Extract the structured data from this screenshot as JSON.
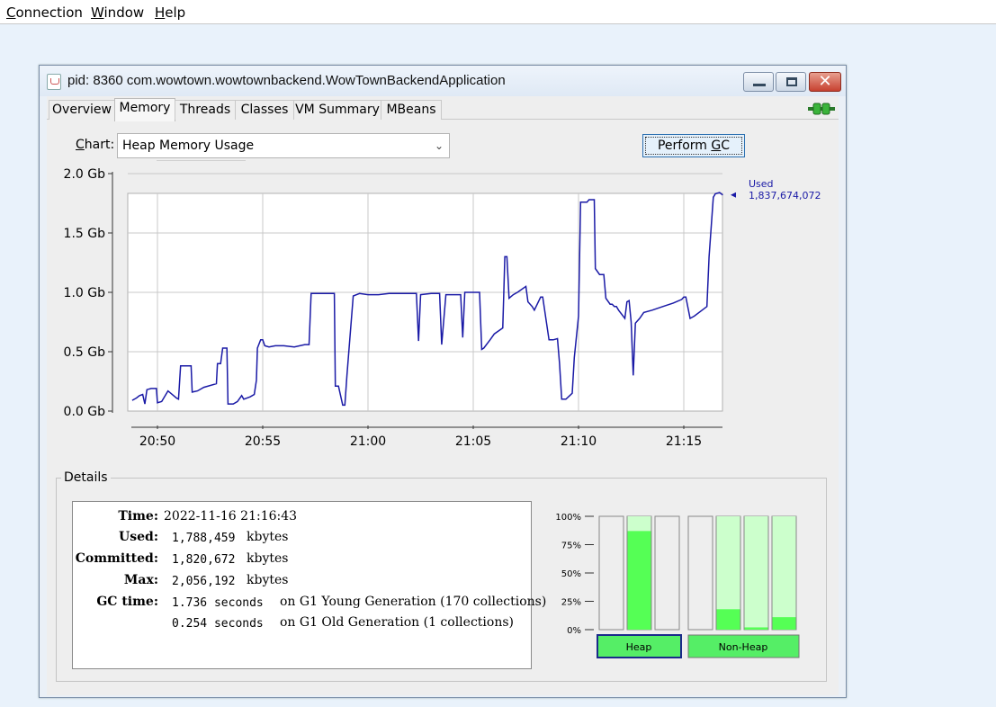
{
  "menubar": {
    "items": [
      {
        "mnemonic": "C",
        "rest": "onnection"
      },
      {
        "mnemonic": "W",
        "rest": "indow"
      },
      {
        "mnemonic": "H",
        "rest": "elp"
      }
    ]
  },
  "window": {
    "title": "pid: 8360 com.wowtown.wowtownbackend.WowTownBackendApplication"
  },
  "tabs": [
    "Overview",
    "Memory",
    "Threads",
    "Classes",
    "VM Summary",
    "MBeans"
  ],
  "selected_tab": "Memory",
  "chart_selector": {
    "label_mnemonic": "C",
    "label_rest": "hart:",
    "selected": "Heap Memory Usage"
  },
  "perform_gc": {
    "prefix": "Perform ",
    "mnemonic": "G",
    "suffix": "C"
  },
  "chart_data": {
    "type": "line",
    "y_ticks": [
      "0.0 Gb",
      "0.5 Gb",
      "1.0 Gb",
      "1.5 Gb",
      "2.0 Gb"
    ],
    "x_ticks": [
      "20:50",
      "20:55",
      "21:00",
      "21:05",
      "21:10",
      "21:15"
    ],
    "ylim": [
      0,
      2.0
    ],
    "series": [
      {
        "name": "Used",
        "value_label": "1,837,674,072",
        "color": "#1a1aa6",
        "points": [
          [
            -1.2,
            0.09
          ],
          [
            -1.0,
            0.11
          ],
          [
            -0.85,
            0.13
          ],
          [
            -0.7,
            0.14
          ],
          [
            -0.6,
            0.06
          ],
          [
            -0.5,
            0.18
          ],
          [
            -0.3,
            0.19
          ],
          [
            -0.05,
            0.19
          ],
          [
            0.0,
            0.07
          ],
          [
            0.2,
            0.08
          ],
          [
            0.5,
            0.17
          ],
          [
            0.9,
            0.11
          ],
          [
            1.0,
            0.1
          ],
          [
            1.1,
            0.38
          ],
          [
            1.6,
            0.38
          ],
          [
            1.65,
            0.16
          ],
          [
            1.9,
            0.17
          ],
          [
            2.2,
            0.2
          ],
          [
            2.8,
            0.23
          ],
          [
            2.85,
            0.4
          ],
          [
            3.0,
            0.4
          ],
          [
            3.1,
            0.53
          ],
          [
            3.3,
            0.53
          ],
          [
            3.35,
            0.06
          ],
          [
            3.6,
            0.06
          ],
          [
            3.8,
            0.08
          ],
          [
            4.0,
            0.13
          ],
          [
            4.1,
            0.1
          ],
          [
            4.4,
            0.12
          ],
          [
            4.6,
            0.14
          ],
          [
            4.7,
            0.26
          ],
          [
            4.75,
            0.53
          ],
          [
            4.9,
            0.6
          ],
          [
            5.0,
            0.6
          ],
          [
            5.1,
            0.55
          ],
          [
            5.3,
            0.54
          ],
          [
            5.6,
            0.55
          ],
          [
            6.0,
            0.55
          ],
          [
            6.5,
            0.54
          ],
          [
            7.0,
            0.56
          ],
          [
            7.2,
            0.56
          ],
          [
            7.3,
            0.99
          ],
          [
            7.6,
            0.99
          ],
          [
            8.2,
            0.99
          ],
          [
            8.4,
            0.99
          ],
          [
            8.45,
            0.21
          ],
          [
            8.6,
            0.21
          ],
          [
            8.8,
            0.05
          ],
          [
            8.9,
            0.05
          ],
          [
            9.0,
            0.3
          ],
          [
            9.3,
            0.97
          ],
          [
            9.6,
            0.99
          ],
          [
            10.0,
            0.98
          ],
          [
            10.5,
            0.98
          ],
          [
            11.0,
            0.99
          ],
          [
            11.5,
            0.99
          ],
          [
            12.0,
            0.99
          ],
          [
            12.3,
            0.99
          ],
          [
            12.4,
            0.59
          ],
          [
            12.5,
            0.98
          ],
          [
            13.0,
            0.99
          ],
          [
            13.4,
            0.99
          ],
          [
            13.5,
            0.56
          ],
          [
            13.7,
            0.98
          ],
          [
            14.0,
            0.98
          ],
          [
            14.4,
            0.98
          ],
          [
            14.5,
            0.62
          ],
          [
            14.6,
            1.0
          ],
          [
            15.0,
            1.0
          ],
          [
            15.3,
            1.0
          ],
          [
            15.4,
            0.52
          ],
          [
            15.5,
            0.53
          ],
          [
            15.8,
            0.6
          ],
          [
            16.0,
            0.65
          ],
          [
            16.4,
            0.7
          ],
          [
            16.5,
            1.3
          ],
          [
            16.6,
            1.3
          ],
          [
            16.7,
            0.95
          ],
          [
            16.9,
            0.98
          ],
          [
            17.1,
            1.0
          ],
          [
            17.5,
            1.05
          ],
          [
            17.6,
            0.92
          ],
          [
            17.8,
            0.88
          ],
          [
            17.9,
            0.85
          ],
          [
            18.2,
            0.96
          ],
          [
            18.3,
            0.96
          ],
          [
            18.6,
            0.6
          ],
          [
            18.8,
            0.6
          ],
          [
            19.0,
            0.61
          ],
          [
            19.1,
            0.4
          ],
          [
            19.2,
            0.1
          ],
          [
            19.4,
            0.1
          ],
          [
            19.7,
            0.15
          ],
          [
            19.8,
            0.45
          ],
          [
            20.0,
            0.8
          ],
          [
            20.1,
            1.76
          ],
          [
            20.4,
            1.76
          ],
          [
            20.5,
            1.78
          ],
          [
            20.75,
            1.78
          ],
          [
            20.8,
            1.2
          ],
          [
            21.0,
            1.15
          ],
          [
            21.2,
            1.15
          ],
          [
            21.3,
            0.95
          ],
          [
            21.5,
            0.9
          ],
          [
            21.6,
            0.9
          ],
          [
            21.7,
            0.88
          ],
          [
            21.8,
            0.88
          ],
          [
            21.9,
            0.85
          ],
          [
            22.2,
            0.78
          ],
          [
            22.3,
            0.92
          ],
          [
            22.4,
            0.93
          ],
          [
            22.5,
            0.75
          ],
          [
            22.6,
            0.3
          ],
          [
            22.7,
            0.74
          ],
          [
            22.9,
            0.78
          ],
          [
            23.1,
            0.83
          ],
          [
            23.5,
            0.85
          ],
          [
            24.0,
            0.88
          ],
          [
            24.5,
            0.91
          ],
          [
            24.9,
            0.94
          ],
          [
            25.0,
            0.96
          ],
          [
            25.1,
            0.96
          ],
          [
            25.3,
            0.78
          ],
          [
            25.5,
            0.8
          ],
          [
            26.1,
            0.88
          ],
          [
            26.2,
            1.3
          ],
          [
            26.4,
            1.8
          ],
          [
            26.5,
            1.83
          ],
          [
            26.7,
            1.84
          ],
          [
            26.85,
            1.82
          ]
        ]
      }
    ]
  },
  "details": {
    "title": "Details",
    "time_label": "Time:",
    "time_value": "2022-11-16 21:16:43",
    "used_label": "Used:",
    "used_value": "1,788,459",
    "used_unit": "kbytes",
    "committed_label": "Committed:",
    "committed_value": "1,820,672",
    "committed_unit": "kbytes",
    "max_label": "Max:",
    "max_value": "2,056,192",
    "max_unit": "kbytes",
    "gc_label": "GC time:",
    "gc1_value": "1.736 seconds",
    "gc1_text": "on G1 Young Generation (170 collections)",
    "gc2_value": "0.254 seconds",
    "gc2_text": "on G1 Old Generation (1 collections)"
  },
  "pool_bars": {
    "pct_labels": [
      "100%",
      "75%",
      "50%",
      "25%",
      "0%"
    ],
    "heap_label": "Heap",
    "nonheap_label": "Non-Heap",
    "heap_bars": [
      {
        "committed": 0.0,
        "used": 0.0
      },
      {
        "committed": 1.0,
        "used": 0.87
      },
      {
        "committed": 0.0,
        "used": 0.0
      }
    ],
    "nonheap_bars": [
      {
        "committed": 0.0,
        "used": 0.0
      },
      {
        "committed": 1.0,
        "used": 0.18
      },
      {
        "committed": 1.0,
        "used": 0.02
      },
      {
        "committed": 1.0,
        "used": 0.11
      }
    ],
    "committed_color": "#ccffcc",
    "used_color": "#55ff55",
    "selected_pool_color": "#55ee66"
  }
}
